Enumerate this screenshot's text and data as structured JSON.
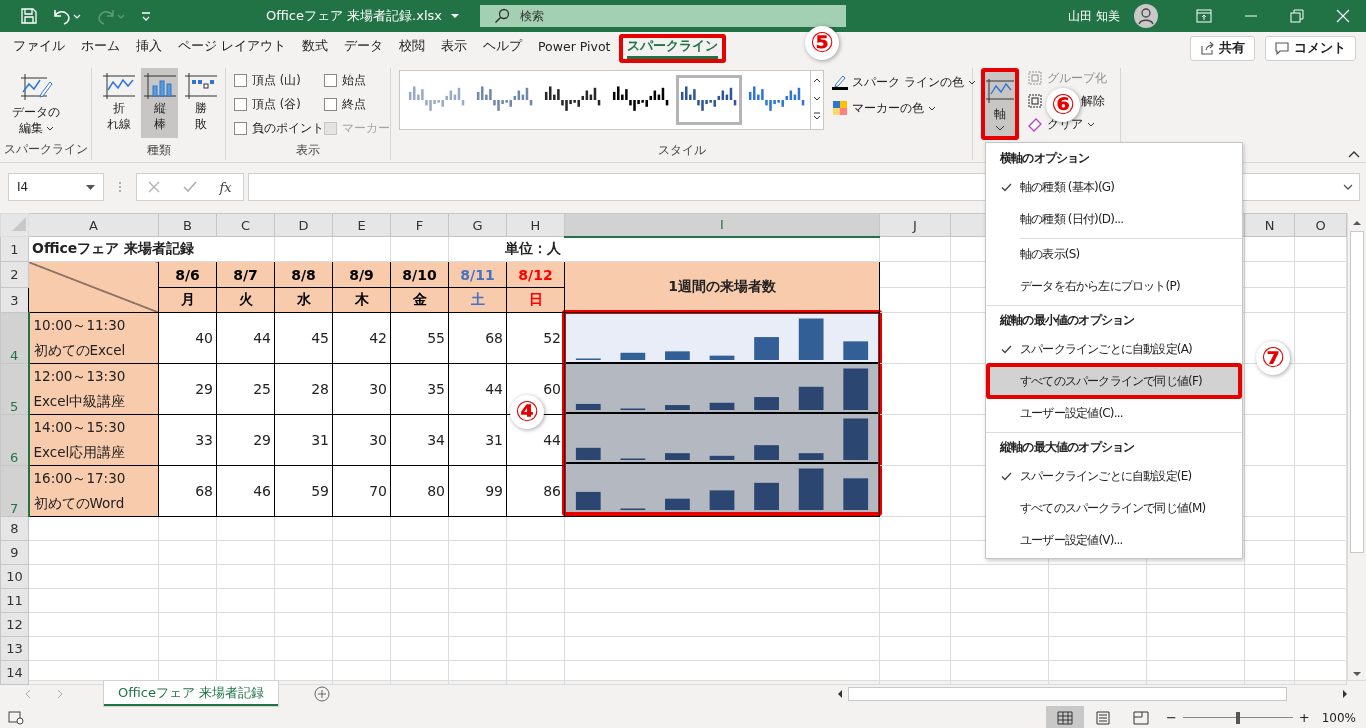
{
  "title_bar": {
    "quick_access": [
      {
        "kind": "save"
      },
      {
        "kind": "undo",
        "disabled": false
      },
      {
        "kind": "redo",
        "disabled": true
      },
      {
        "kind": "customize"
      }
    ],
    "title": "Officeフェア 来場者記録.xlsx",
    "search": {
      "placeholder": "検索"
    },
    "user": "山田 知美"
  },
  "tabs": [
    {
      "label": "ファイル",
      "selected": false,
      "highlighted": false
    },
    {
      "label": "ホーム",
      "selected": false,
      "highlighted": false
    },
    {
      "label": "挿入",
      "selected": false,
      "highlighted": false
    },
    {
      "label": "ページ レイアウト",
      "selected": false,
      "highlighted": false
    },
    {
      "label": "数式",
      "selected": false,
      "highlighted": false
    },
    {
      "label": "データ",
      "selected": false,
      "highlighted": false
    },
    {
      "label": "校閲",
      "selected": false,
      "highlighted": false
    },
    {
      "label": "表示",
      "selected": false,
      "highlighted": false
    },
    {
      "label": "ヘルプ",
      "selected": false,
      "highlighted": false
    },
    {
      "label": "Power Pivot",
      "selected": false,
      "highlighted": false
    },
    {
      "label": "スパークライン",
      "selected": true,
      "highlighted": true
    }
  ],
  "share_button": "共有",
  "comment_button": "コメント",
  "ribbon": {
    "sparkline_group": {
      "label": "スパークライン",
      "edit_button": [
        "データの",
        "編集"
      ]
    },
    "type_group": {
      "label": "種類",
      "buttons": [
        {
          "kind": "line",
          "lines": [
            "折",
            "れ線"
          ],
          "selected": false
        },
        {
          "kind": "column",
          "lines": [
            "縦",
            "棒"
          ],
          "selected": true
        },
        {
          "kind": "winloss",
          "lines": [
            "勝",
            "敗"
          ],
          "selected": false
        }
      ]
    },
    "show_group": {
      "label": "表示",
      "checkboxes": [
        {
          "label": "頂点 (山)",
          "checked": false,
          "disabled": false
        },
        {
          "label": "頂点 (谷)",
          "checked": false,
          "disabled": false
        },
        {
          "label": "負のポイント",
          "checked": false,
          "disabled": false
        },
        {
          "label": "始点",
          "checked": false,
          "disabled": false
        },
        {
          "label": "終点",
          "checked": false,
          "disabled": false
        },
        {
          "label": "マーカー",
          "checked": false,
          "disabled": true
        }
      ]
    },
    "style_group": {
      "label": "スタイル",
      "styles": [
        {
          "color": "#9aa9c4",
          "selected": false
        },
        {
          "color": "#6f86ad",
          "selected": false
        },
        {
          "color": "#262626",
          "selected": false
        },
        {
          "color": "#000000",
          "selected": false
        },
        {
          "color": "#2f5597",
          "selected": true
        },
        {
          "color": "#2e75d6",
          "selected": false
        }
      ],
      "color_buttons": [
        "スパーク ラインの色",
        "マーカーの色"
      ]
    },
    "axis_button": {
      "label": "軸",
      "highlighted": true
    },
    "small_buttons": [
      {
        "kind": "group",
        "label": "グループ化",
        "disabled": true
      },
      {
        "kind": "ungroup",
        "label": "解除",
        "disabled": false
      },
      {
        "kind": "clear",
        "label": "クリア",
        "disabled": false
      }
    ]
  },
  "formula_bar": {
    "name_box": "I4",
    "insert_function": "fx"
  },
  "sheet": {
    "columns": [
      {
        "label": "A",
        "selected": false
      },
      {
        "label": "B",
        "selected": false
      },
      {
        "label": "C",
        "selected": false
      },
      {
        "label": "D",
        "selected": false
      },
      {
        "label": "E",
        "selected": false
      },
      {
        "label": "F",
        "selected": false
      },
      {
        "label": "G",
        "selected": false
      },
      {
        "label": "H",
        "selected": false
      },
      {
        "label": "I",
        "selected": true
      },
      {
        "label": "J",
        "selected": false
      },
      {
        "label": "N",
        "selected": false
      },
      {
        "label": "O",
        "selected": false
      }
    ],
    "row_numbers": [
      {
        "label": "1",
        "selected": false
      },
      {
        "label": "2",
        "selected": false
      },
      {
        "label": "3",
        "selected": false
      },
      {
        "label": "4",
        "selected": true
      },
      {
        "label": "5",
        "selected": true
      },
      {
        "label": "6",
        "selected": true
      },
      {
        "label": "7",
        "selected": true
      },
      {
        "label": "8",
        "selected": false
      },
      {
        "label": "9",
        "selected": false
      },
      {
        "label": "10",
        "selected": false
      },
      {
        "label": "11",
        "selected": false
      },
      {
        "label": "12",
        "selected": false
      },
      {
        "label": "13",
        "selected": false
      },
      {
        "label": "14",
        "selected": false
      }
    ],
    "title": "Officeフェア 来場者記録",
    "unit": "単位：人",
    "dates": [
      {
        "date": "8/6",
        "weekday": "月",
        "color": "#000000"
      },
      {
        "date": "8/7",
        "weekday": "火",
        "color": "#000000"
      },
      {
        "date": "8/8",
        "weekday": "水",
        "color": "#000000"
      },
      {
        "date": "8/9",
        "weekday": "木",
        "color": "#000000"
      },
      {
        "date": "8/10",
        "weekday": "金",
        "color": "#000000"
      },
      {
        "date": "8/11",
        "weekday": "土",
        "color": "#4472c4"
      },
      {
        "date": "8/12",
        "weekday": "日",
        "color": "#ff0000"
      }
    ],
    "chart_header": "1週間の来場者数",
    "rows": [
      {
        "time": "10:00～11:30",
        "course": "初めてのExcel",
        "values": [
          "40",
          "44",
          "45",
          "42",
          "55",
          "68",
          "52"
        ],
        "active": true
      },
      {
        "time": "12:00～13:30",
        "course": "Excel中級講座",
        "values": [
          "29",
          "25",
          "28",
          "30",
          "35",
          "44",
          "60"
        ],
        "active": false
      },
      {
        "time": "14:00～15:30",
        "course": "Excel応用講座",
        "values": [
          "33",
          "29",
          "31",
          "30",
          "34",
          "31",
          "44"
        ],
        "active": false
      },
      {
        "time": "16:00～17:30",
        "course": "初めてのWord",
        "values": [
          "68",
          "46",
          "59",
          "70",
          "80",
          "99",
          "86"
        ],
        "active": false
      }
    ],
    "sparklines_highlighted": true
  },
  "menu": {
    "sections": [
      {
        "heading": "横軸のオプション",
        "items": [
          {
            "label": "軸の種類 (基本)(G)",
            "checked": true,
            "selected": false,
            "highlighted": false
          },
          {
            "label": "軸の種類 (日付)(D)...",
            "checked": false,
            "selected": false,
            "highlighted": false
          }
        ]
      },
      {
        "items": [
          {
            "label": "軸の表示(S)",
            "checked": false,
            "selected": false,
            "highlighted": false
          },
          {
            "label": "データを右から左にプロット(P)",
            "checked": false,
            "selected": false,
            "highlighted": false
          }
        ]
      },
      {
        "heading": "縦軸の最小値のオプション",
        "items": [
          {
            "label": "スパークラインごとに自動設定(A)",
            "checked": true,
            "selected": false,
            "highlighted": false
          },
          {
            "label": "すべてのスパークラインで同じ値(F)",
            "checked": false,
            "selected": true,
            "highlighted": true
          },
          {
            "label": "ユーザー設定値(C)...",
            "checked": false,
            "selected": false,
            "highlighted": false
          }
        ]
      },
      {
        "heading": "縦軸の最大値のオプション",
        "items": [
          {
            "label": "スパークラインごとに自動設定(E)",
            "checked": true,
            "selected": false,
            "highlighted": false
          },
          {
            "label": "すべてのスパークラインで同じ値(M)",
            "checked": false,
            "selected": false,
            "highlighted": false
          },
          {
            "label": "ユーザー設定値(V)...",
            "checked": false,
            "selected": false,
            "highlighted": false
          }
        ]
      }
    ]
  },
  "callouts": [
    {
      "label": "④"
    },
    {
      "label": "⑤"
    },
    {
      "label": "⑥"
    },
    {
      "label": "⑦"
    }
  ],
  "sheet_tabs": [
    {
      "label": "Officeフェア 来場者記録",
      "selected": true
    }
  ],
  "status_bar": {
    "views": [
      {
        "kind": "normal",
        "selected": true
      },
      {
        "kind": "page_layout",
        "selected": false
      },
      {
        "kind": "page_break",
        "selected": false
      }
    ],
    "zoom_out": "−",
    "zoom_in": "+",
    "zoom": {
      "level": 0.5,
      "reading": "100%"
    }
  }
}
